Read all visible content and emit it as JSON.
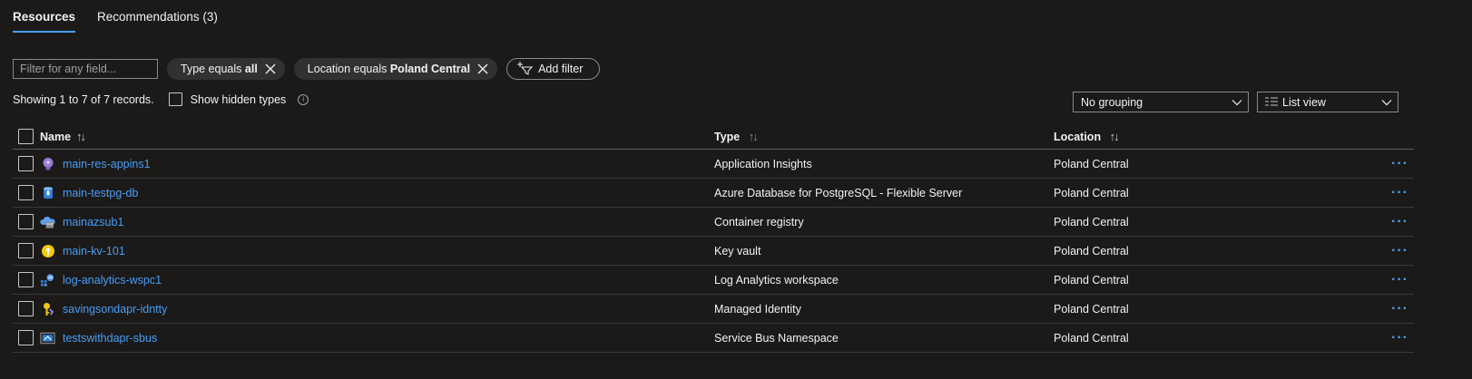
{
  "tabs": [
    {
      "label": "Resources",
      "active": true
    },
    {
      "label": "Recommendations (3)",
      "active": false
    }
  ],
  "filters": {
    "search_placeholder": "Filter for any field...",
    "pills": [
      {
        "prefix": "Type equals ",
        "value": "all"
      },
      {
        "prefix": "Location equals ",
        "value": "Poland Central"
      }
    ],
    "add_filter_label": "Add filter"
  },
  "records_text": "Showing 1 to 7 of 7 records.",
  "show_hidden_label": "Show hidden types",
  "grouping": {
    "selected": "No grouping"
  },
  "view": {
    "selected": "List view"
  },
  "columns": {
    "name": "Name",
    "type": "Type",
    "location": "Location"
  },
  "rows": [
    {
      "name": "main-res-appins1",
      "type": "Application Insights",
      "location": "Poland Central",
      "icon": "application-insights-icon"
    },
    {
      "name": "main-testpg-db",
      "type": "Azure Database for PostgreSQL - Flexible Server",
      "location": "Poland Central",
      "icon": "postgresql-icon"
    },
    {
      "name": "mainazsub1",
      "type": "Container registry",
      "location": "Poland Central",
      "icon": "container-registry-icon"
    },
    {
      "name": "main-kv-101",
      "type": "Key vault",
      "location": "Poland Central",
      "icon": "key-vault-icon"
    },
    {
      "name": "log-analytics-wspc1",
      "type": "Log Analytics workspace",
      "location": "Poland Central",
      "icon": "log-analytics-icon"
    },
    {
      "name": "savingsondapr-idntty",
      "type": "Managed Identity",
      "location": "Poland Central",
      "icon": "managed-identity-icon"
    },
    {
      "name": "testswithdapr-sbus",
      "type": "Service Bus Namespace",
      "location": "Poland Central",
      "icon": "service-bus-icon"
    }
  ],
  "colors": {
    "accent": "#479ef5",
    "background": "#1b1a19",
    "text": "#f3f2f1"
  }
}
